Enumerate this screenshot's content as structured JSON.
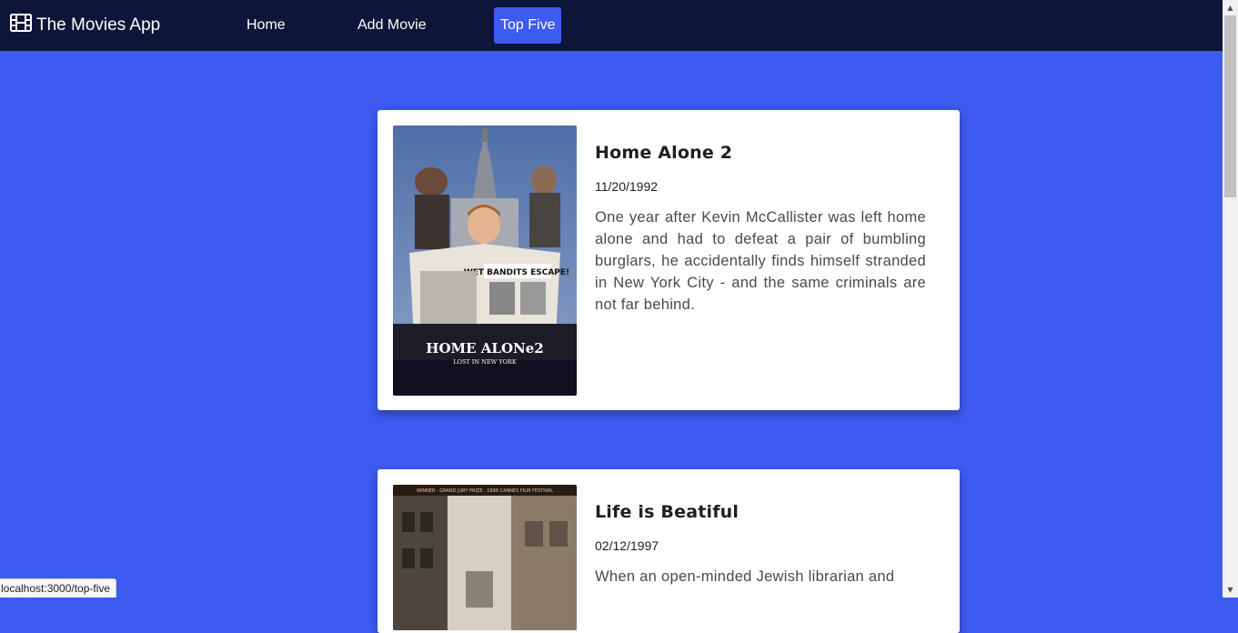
{
  "navbar": {
    "brand": "The Movies App",
    "brand_icon": "film-icon",
    "links": [
      {
        "label": "Home",
        "active": false
      },
      {
        "label": "Add Movie",
        "active": false
      },
      {
        "label": "Top Five",
        "active": true
      }
    ]
  },
  "movies": [
    {
      "title": "Home Alone 2",
      "date": "11/20/1992",
      "description": "One year after Kevin McCallister was left home alone and had to defeat a pair of bumbling burglars, he accidentally finds himself stranded in New York City - and the same criminals are not far behind.",
      "poster_text": [
        "HOME ALONe2",
        "LOST IN NEW YORK",
        "WET BANDITS ESCAPE!"
      ]
    },
    {
      "title": "Life is Beatiful",
      "date": "02/12/1997",
      "description": "When an open-minded Jewish librarian and",
      "poster_text": [
        "WINNER · GRAND JURY PRIZE · 1998 CANNES FILM FESTIVAL"
      ]
    }
  ],
  "status_bar": {
    "url": "localhost:3000/top-five"
  },
  "colors": {
    "background": "#3d5af1",
    "navbar": "#0d1538",
    "card": "#ffffff"
  }
}
